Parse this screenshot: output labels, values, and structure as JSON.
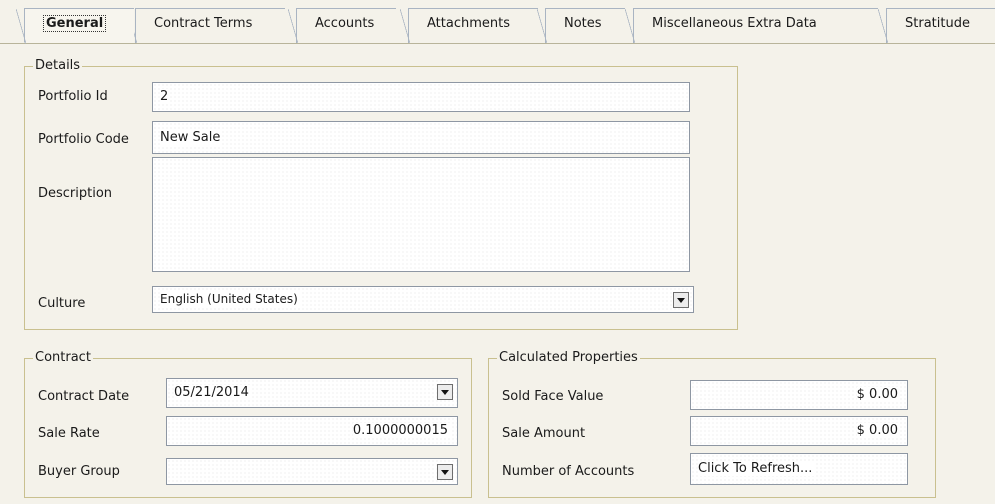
{
  "tabs": [
    {
      "label": "General",
      "active": true
    },
    {
      "label": "Contract Terms"
    },
    {
      "label": "Accounts"
    },
    {
      "label": "Attachments"
    },
    {
      "label": "Notes"
    },
    {
      "label": "Miscellaneous Extra Data"
    },
    {
      "label": "Stratitude"
    }
  ],
  "details": {
    "legend": "Details",
    "portfolio_id_label": "Portfolio Id",
    "portfolio_id_value": "2",
    "portfolio_code_label": "Portfolio Code",
    "portfolio_code_value": "New Sale",
    "description_label": "Description",
    "description_value": "",
    "culture_label": "Culture",
    "culture_value": "English (United States)"
  },
  "contract": {
    "legend": "Contract",
    "contract_date_label": "Contract Date",
    "contract_date_value": "05/21/2014",
    "sale_rate_label": "Sale Rate",
    "sale_rate_value": "0.1000000015",
    "buyer_group_label": "Buyer Group",
    "buyer_group_value": ""
  },
  "calculated": {
    "legend": "Calculated Properties",
    "sold_face_value_label": "Sold Face Value",
    "sold_face_value_value": "$ 0.00",
    "sale_amount_label": "Sale Amount",
    "sale_amount_value": "$ 0.00",
    "number_of_accounts_label": "Number of Accounts",
    "number_of_accounts_value": "Click To Refresh..."
  },
  "icons": {
    "dropdown": "chevron-down-icon"
  },
  "colors": {
    "background": "#f4f2ea",
    "group_border": "#c9c08f",
    "tab_border": "#a9b4c2"
  }
}
